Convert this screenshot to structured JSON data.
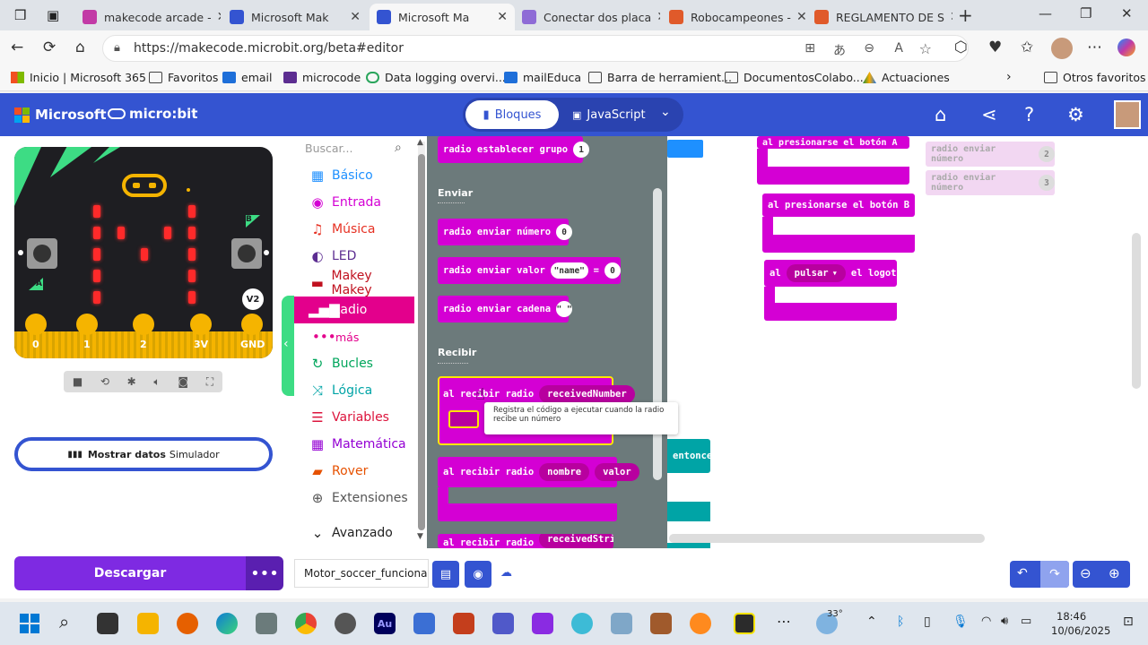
{
  "browser": {
    "tabs": [
      {
        "label": "makecode arcade -",
        "color": "#c23aa6"
      },
      {
        "label": "Microsoft Mak",
        "color": "#3454d1"
      },
      {
        "label": "Microsoft Ma",
        "color": "#3454d1"
      },
      {
        "label": "Conectar dos placa",
        "color": "#8e6bd6"
      },
      {
        "label": "Robocampeones -",
        "color": "#e05a2a"
      },
      {
        "label": "REGLAMENTO DE S",
        "color": "#e05a2a"
      }
    ],
    "url": "https://makecode.microbit.org/beta#editor",
    "favorites": [
      "Inicio | Microsoft 365",
      "Favoritos",
      "email",
      "microcode",
      "Data logging overvi...",
      "mailEduca",
      "Barra de herramient...",
      "DocumentosColabo...",
      "Actuaciones",
      "Otros favoritos"
    ]
  },
  "header": {
    "brand": "Microsoft",
    "product": "micro:bit",
    "blocks_label": "Bloques",
    "js_label": "JavaScript"
  },
  "simulator": {
    "badge": "V2",
    "button_a": "A",
    "button_b": "B",
    "pins": [
      "0",
      "1",
      "2",
      "3V",
      "GND"
    ],
    "show_data_bold": "Mostrar datos",
    "show_data_rest": "Simulador"
  },
  "toolbox": {
    "search_placeholder": "Buscar...",
    "categories": [
      {
        "label": "Básico",
        "color": "#1e90ff",
        "icon": "grid-icon"
      },
      {
        "label": "Entrada",
        "color": "#d400d4",
        "icon": "circle-icon"
      },
      {
        "label": "Música",
        "color": "#e63022",
        "icon": "headphones-icon"
      },
      {
        "label": "LED",
        "color": "#5c2d91",
        "icon": "toggle-icon"
      },
      {
        "label": "Makey Makey",
        "color": "#c0111f",
        "icon": "keyboard-icon"
      },
      {
        "label": "Radio",
        "color": "#e3008c",
        "icon": "bars-icon"
      },
      {
        "label": "más",
        "color": "#e3008c",
        "icon": "dots-icon"
      },
      {
        "label": "Bucles",
        "color": "#00a65c",
        "icon": "refresh-icon"
      },
      {
        "label": "Lógica",
        "color": "#00a4a6",
        "icon": "shuffle-icon"
      },
      {
        "label": "Variables",
        "color": "#dc143c",
        "icon": "lines-icon"
      },
      {
        "label": "Matemática",
        "color": "#9400d3",
        "icon": "calc-icon"
      },
      {
        "label": "Rover",
        "color": "#e65100",
        "icon": "car-icon"
      },
      {
        "label": "Extensiones",
        "color": "#555555",
        "icon": "plus-icon"
      },
      {
        "label": "Avanzado",
        "color": "#222222",
        "icon": "chevron-down-icon"
      }
    ]
  },
  "flyout": {
    "set_group": "radio establecer grupo",
    "set_group_value": "1",
    "enviar_label": "Enviar",
    "send_number": "radio enviar número",
    "send_number_value": "0",
    "send_value": "radio enviar valor",
    "send_value_name": "\"name\"",
    "send_value_eq": "=",
    "send_value_value": "0",
    "send_string": "radio enviar cadena",
    "send_string_value": "\" \"",
    "recibir_label": "Recibir",
    "on_received": "al recibir radio",
    "received_number": "receivedNumber",
    "tooltip": "Registra el código a ejecutar cuando la radio recibe un número",
    "on_received_name": "al recibir radio",
    "name_var": "nombre",
    "value_var": "valor",
    "on_received_string": "al recibir radio",
    "received_string": "receivedString"
  },
  "workspace": {
    "btn_a_block": "al presionarse el botón  A",
    "btn_b_block": "al presionarse el botón  B",
    "logo_block_prefix": "al",
    "logo_block_action": "pulsar",
    "logo_block_suffix": "el logotipo",
    "ghost1": "radio enviar número",
    "ghost1_value": "2",
    "ghost2": "radio enviar número",
    "ghost2_value": "3",
    "entonces": "entonces"
  },
  "bottom": {
    "download": "Descargar",
    "project_name": "Motor_soccer_funciona"
  },
  "taskbar": {
    "temperature": "33°",
    "time": "18:46",
    "date": "10/06/2025"
  }
}
